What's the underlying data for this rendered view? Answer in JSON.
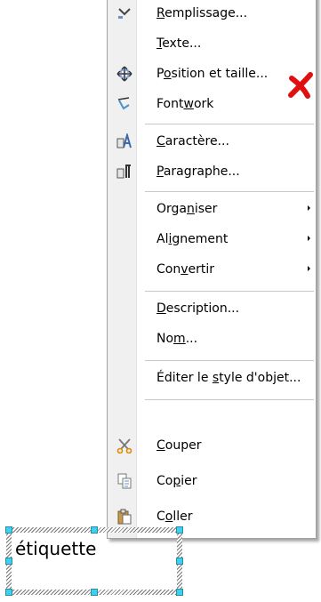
{
  "context_menu": {
    "items": [
      {
        "pre": "",
        "mn": "R",
        "post": "emplissage...",
        "icon": "fill-icon"
      },
      {
        "pre": "",
        "mn": "T",
        "post": "exte...",
        "icon": ""
      },
      {
        "pre": "P",
        "mn": "o",
        "post": "sition et taille...",
        "icon": "position-size-icon"
      },
      {
        "pre": "Font",
        "mn": "w",
        "post": "ork",
        "icon": "fontwork-icon"
      },
      {
        "pre": "",
        "mn": "C",
        "post": "aractère...",
        "icon": "character-icon"
      },
      {
        "pre": "",
        "mn": "P",
        "post": "aragraphe...",
        "icon": "paragraph-icon"
      },
      {
        "pre": "Orga",
        "mn": "n",
        "post": "iser",
        "icon": ""
      },
      {
        "pre": "Al",
        "mn": "i",
        "post": "gnement",
        "icon": ""
      },
      {
        "pre": "Con",
        "mn": "v",
        "post": "ertir",
        "icon": ""
      },
      {
        "pre": "",
        "mn": "D",
        "post": "escription...",
        "icon": ""
      },
      {
        "pre": "No",
        "mn": "m",
        "post": "...",
        "icon": ""
      },
      {
        "pre": "Éditer le ",
        "mn": "s",
        "post": "tyle d'objet...",
        "icon": ""
      },
      {
        "pre": "",
        "mn": "C",
        "post": "ouper",
        "icon": "cut-icon"
      },
      {
        "pre": "Co",
        "mn": "p",
        "post": "ier",
        "icon": "copy-icon"
      },
      {
        "pre": "C",
        "mn": "o",
        "post": "ller",
        "icon": "paste-icon"
      }
    ]
  },
  "annotation": {
    "mark": "red-x-mark",
    "color": "#e01010"
  },
  "frame": {
    "text": "étiquette"
  }
}
